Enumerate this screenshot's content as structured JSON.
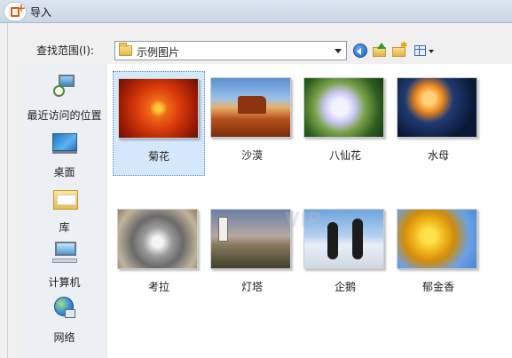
{
  "window": {
    "title": "导入"
  },
  "lookin": {
    "label": "查找范围(I):",
    "value": "示例图片"
  },
  "toolbar": {
    "icons": [
      "back-icon",
      "up-folder-icon",
      "new-folder-icon",
      "view-menu-icon"
    ]
  },
  "places": [
    {
      "label": "最近访问的位置",
      "icon": "recent-places-icon"
    },
    {
      "label": "桌面",
      "icon": "desktop-icon"
    },
    {
      "label": "库",
      "icon": "libraries-icon"
    },
    {
      "label": "计算机",
      "icon": "computer-icon"
    },
    {
      "label": "网络",
      "icon": "network-icon"
    }
  ],
  "files": [
    {
      "name": "菊花",
      "selected": true
    },
    {
      "name": "沙漠",
      "selected": false
    },
    {
      "name": "八仙花",
      "selected": false
    },
    {
      "name": "水母",
      "selected": false
    },
    {
      "name": "考拉",
      "selected": false
    },
    {
      "name": "灯塔",
      "selected": false
    },
    {
      "name": "企鹅",
      "selected": false
    },
    {
      "name": "郁金香",
      "selected": false
    }
  ],
  "watermark": "VIP"
}
